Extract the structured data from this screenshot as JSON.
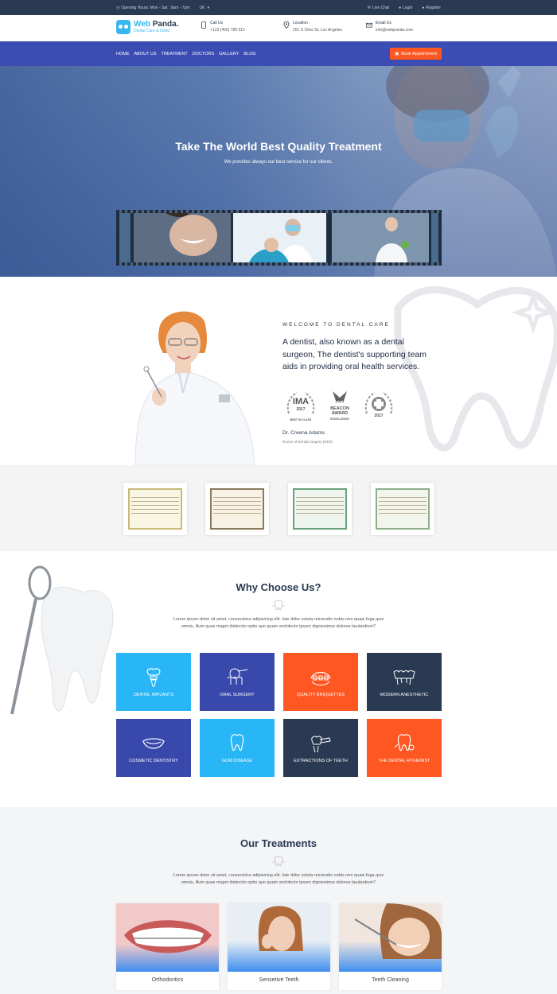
{
  "topbar": {
    "hours": "Opening Hours: Mon - Sat : 9am - 7pm",
    "language": "UK",
    "live_chat": "Live Chat",
    "login": "Login",
    "register": "Register"
  },
  "header": {
    "logo_name_a": "Web",
    "logo_name_b": " Panda.",
    "logo_tagline": "Dental Care & Clinic",
    "call": {
      "label": "Call Us",
      "value": "+123 (456) 789 012"
    },
    "location": {
      "label": "Location",
      "value": "251 S Olive St, Los Angeles"
    },
    "email": {
      "label": "Email Us",
      "value": "info@webpanda.com"
    }
  },
  "nav": {
    "items": [
      "HOME",
      "ABOUT US",
      "TREATMENT",
      "DOCTORS",
      "GALLERY",
      "BLOG"
    ],
    "book": "Book Appointment"
  },
  "hero": {
    "title": "Take The World Best Quality Treatment",
    "subtitle": "We provides always our best service for our clients."
  },
  "welcome": {
    "kicker": "WELCOME TO DENTAL CARE",
    "lead": "A dentist, also known as a dental surgeon, The dentist's supporting team aids in providing oral health services.",
    "awards": [
      {
        "big": "IMA",
        "small": "2017",
        "foot": "BEST IN CLASS"
      },
      {
        "big": "2021",
        "small": "BEACON AWARD",
        "foot": "EXCELLENCE"
      },
      {
        "big": "",
        "small": "2017",
        "foot": ""
      }
    ],
    "doctor_name": "Dr. Creena Adams",
    "doctor_role": "Doctor of Dental Surgery (DDS)"
  },
  "why": {
    "title": "Why Choose Us?",
    "intro": "Lorem ipsum dolor sit amet, consectetur adipisicing elit. Iste dolor soluta reiciendis nobis rem quasi fuga quis omnis, illum quas magni distinctio optio quo quam architecto ipsum dignissimos dolores laudantium?",
    "services": [
      {
        "label": "DENTAL IMPLANTS",
        "color": "#29b6f6",
        "icon": "dental-implant-icon"
      },
      {
        "label": "ORAL SURGERY",
        "color": "#3949ab",
        "icon": "oral-surgery-icon"
      },
      {
        "label": "QUALITY BRIQUETTES",
        "color": "#ff5722",
        "icon": "braces-icon"
      },
      {
        "label": "MODERN ANESTHETIC",
        "color": "#2a3a52",
        "icon": "teeth-row-icon"
      },
      {
        "label": "COSMETIC DENTISTRY",
        "color": "#3949ab",
        "icon": "smile-icon"
      },
      {
        "label": "GUM DISEASE",
        "color": "#29b6f6",
        "icon": "tooth-icon"
      },
      {
        "label": "EXTRACTIONS OF TEETH",
        "color": "#2a3a52",
        "icon": "extraction-icon"
      },
      {
        "label": "THE DENTAL HYGIENIST",
        "color": "#ff5722",
        "icon": "hygienist-icon"
      }
    ]
  },
  "treatments": {
    "title": "Our Treatments",
    "intro": "Lorem ipsum dolor sit amet, consectetur adipisicing elit. Iste dolor soluta reiciendis nobis rem quasi fuga quis omnis, illum quas magni distinctio optio quo quam architecto ipsum dignissimos dolores laudantium?",
    "items": [
      {
        "label": "Orthodontics"
      },
      {
        "label": "Sensetive Teeth"
      },
      {
        "label": "Teeth Cleaning"
      }
    ]
  },
  "colors": {
    "navy": "#2a3a52",
    "nav": "#3b4db3",
    "accent": "#ff5722",
    "sky": "#29b6f6"
  }
}
